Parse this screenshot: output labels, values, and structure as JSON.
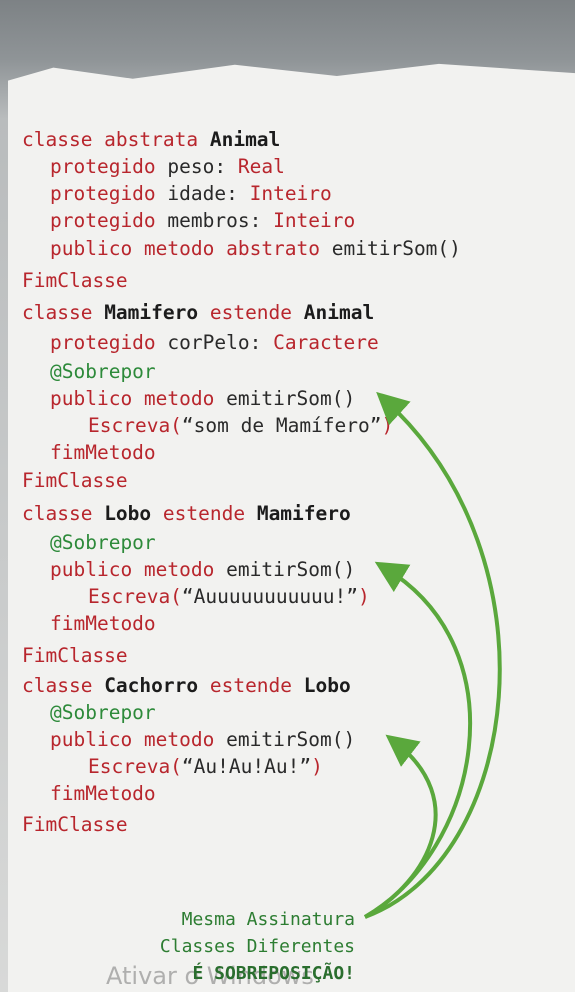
{
  "code_lines": {
    "l1": {
      "kw1": "classe abstrata ",
      "name": "Animal"
    },
    "l2": {
      "kw": "protegido ",
      "tx": "peso: ",
      "type": "Real"
    },
    "l3": {
      "kw": "protegido ",
      "tx": "idade: ",
      "type": "Inteiro"
    },
    "l4": {
      "kw": "protegido ",
      "tx": "membros: ",
      "type": "Inteiro"
    },
    "l5": {
      "kw": "publico metodo abstrato ",
      "tx": "emitirSom()"
    },
    "l6": {
      "kw": "FimClasse"
    },
    "l7": {
      "kw1": "classe ",
      "name": "Mamifero",
      "kw2": " estende ",
      "parent": "Animal"
    },
    "l8": {
      "kw": "protegido ",
      "tx": "corPelo: ",
      "type": "Caractere"
    },
    "l9": {
      "an": "@Sobrepor"
    },
    "l10": {
      "kw": "publico metodo ",
      "tx": "emitirSom()"
    },
    "l11": {
      "kw": "Escreva(",
      "tx": "“som de Mamífero”",
      "kw2": ")"
    },
    "l12": {
      "kw": "fimMetodo"
    },
    "l13": {
      "kw": "FimClasse"
    },
    "l14": {
      "kw1": "classe ",
      "name": "Lobo",
      "kw2": " estende ",
      "parent": "Mamifero"
    },
    "l15": {
      "an": "@Sobrepor"
    },
    "l16": {
      "kw": "publico metodo ",
      "tx": "emitirSom()"
    },
    "l17": {
      "kw": "Escreva(",
      "tx": "“Auuuuuuuuuuu!”",
      "kw2": ")"
    },
    "l18": {
      "kw": "fimMetodo"
    },
    "l19": {
      "kw": "FimClasse"
    },
    "l20": {
      "kw1": "classe ",
      "name": "Cachorro",
      "kw2": " estende ",
      "parent": "Lobo"
    },
    "l21": {
      "an": "@Sobrepor"
    },
    "l22": {
      "kw": "publico metodo ",
      "tx": "emitirSom()"
    },
    "l23": {
      "kw": "Escreva(",
      "tx": "“Au!Au!Au!”",
      "kw2": ")"
    },
    "l24": {
      "kw": "fimMetodo"
    },
    "l25": {
      "kw": "FimClasse"
    }
  },
  "note": {
    "line1": "Mesma Assinatura",
    "line2": "Classes Diferentes",
    "line3": "É SOBREPOSIÇÃO!"
  },
  "watermark": "Ativar o Windows",
  "colors": {
    "keyword": "#b8262d",
    "annotation": "#2d8a3a",
    "arrow": "#5aa83c",
    "text": "#1c1c1c"
  }
}
